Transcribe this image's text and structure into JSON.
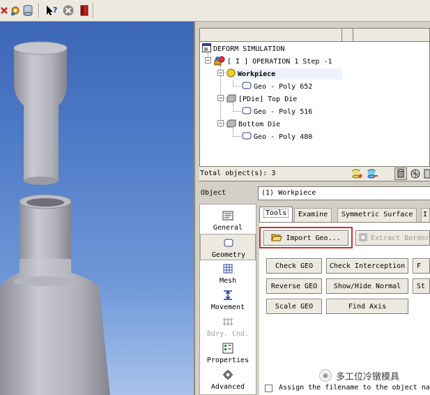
{
  "toolbar": {
    "icons": [
      "red-x-icon",
      "gear-wrench-icon",
      "database-icon",
      "help-pointer-icon",
      "cancel-circle-icon",
      "exit-door-icon"
    ]
  },
  "tree": {
    "root": "DEFORM SIMULATION",
    "operation": "[ I ]  OPERATION 1  Step -1",
    "workpiece": "Workpiece",
    "workpiece_geo": "Geo - Poly 652",
    "top_die": "[PDie] Top Die",
    "top_die_geo": "Geo - Poly 516",
    "bottom_die": "Bottom Die",
    "bottom_die_geo": "Geo - Poly 480"
  },
  "status": {
    "total_objects": "Total object(s): 3"
  },
  "object_row": {
    "label": "Object",
    "value": "(1) Workpiece"
  },
  "categories": {
    "general": "General",
    "geometry": "Geometry",
    "mesh": "Mesh",
    "movement": "Movement",
    "bdry": "Bdry. Cnd.",
    "properties": "Properties",
    "advanced": "Advanced"
  },
  "tabs": {
    "tools": "Tools",
    "examine": "Examine",
    "symmetric": "Symmetric Surface",
    "more": "I"
  },
  "buttons": {
    "import_geo": "Import Geo...",
    "extract_border": "Extract Border",
    "check_geo": "Check GEO",
    "check_interception": "Check Interception",
    "reverse_geo": "Reverse GEO",
    "show_hide_normal": "Show/Hide Normal",
    "scale_geo": "Scale GEO",
    "find_axis": "Find Axis",
    "partial_1": "F",
    "partial_2": "St"
  },
  "assign": {
    "label": "Assign the filename to the object na"
  },
  "watermark": "多工位冷镦模具",
  "colors": {
    "highlight_red": "#d62a26",
    "viewport_blue": "#4d7ac6",
    "workpiece_yellow": "#f2d21a"
  }
}
